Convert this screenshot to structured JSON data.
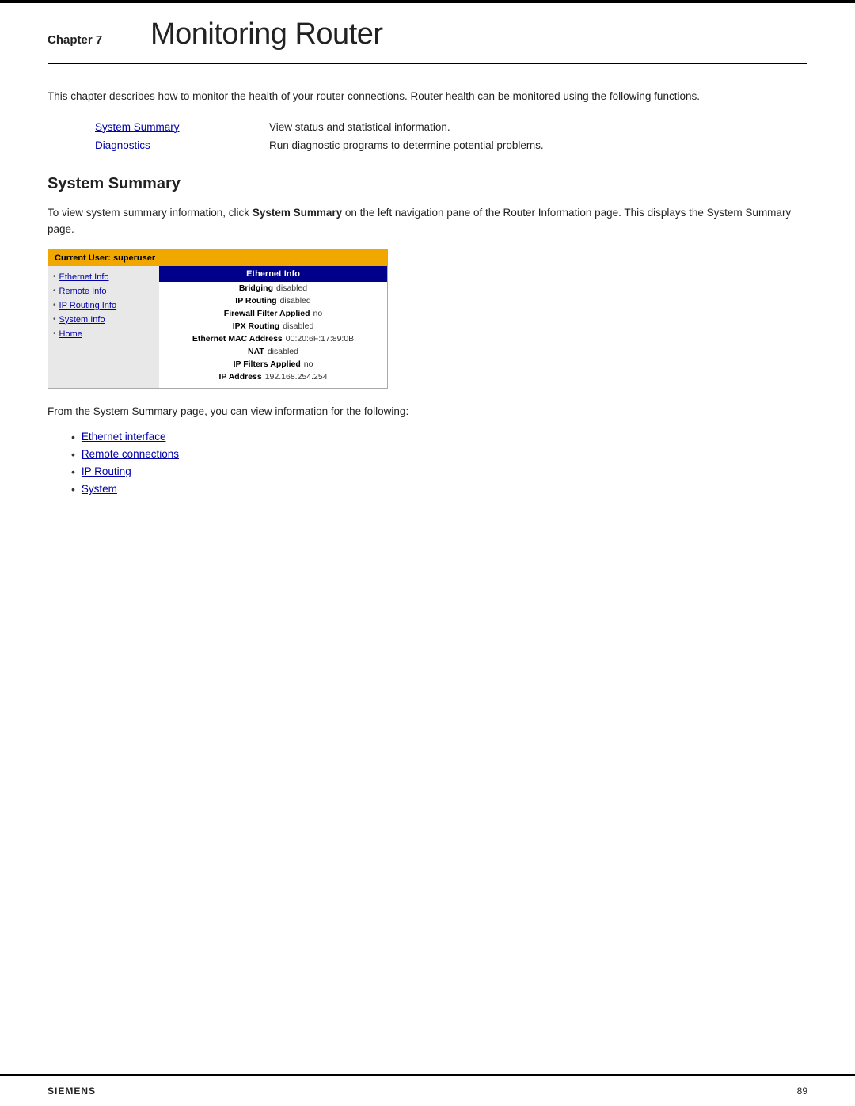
{
  "top_border": true,
  "header": {
    "chapter_label": "Chapter 7",
    "chapter_title": "Monitoring Router"
  },
  "intro": {
    "text": "This chapter describes how to monitor the health of your router connections. Router health can be monitored using the following functions."
  },
  "functions": [
    {
      "link": "System Summary",
      "description": "View status and statistical information."
    },
    {
      "link": "Diagnostics",
      "description": "Run diagnostic programs to determine potential problems."
    }
  ],
  "system_summary": {
    "heading": "System Summary",
    "text": "To view system summary information, click System Summary on the left navigation pane of the Router Information page. This displays the System Summary page.",
    "bold_part": "System Summary",
    "screenshot": {
      "top_bar": "Current User: superuser",
      "nav_items": [
        "Ethernet Info",
        "Remote Info",
        "IP Routing Info",
        "System Info",
        "Home"
      ],
      "info_panel_title": "Ethernet Info",
      "info_rows": [
        {
          "label": "Bridging",
          "value": "disabled"
        },
        {
          "label": "IP Routing",
          "value": "disabled"
        },
        {
          "label": "Firewall Filter Applied",
          "value": "no"
        },
        {
          "label": "IPX Routing",
          "value": "disabled"
        },
        {
          "label": "Ethernet MAC Address",
          "value": "00:20:6F:17:89:0B"
        },
        {
          "label": "NAT",
          "value": "disabled"
        },
        {
          "label": "IP Filters Applied",
          "value": "no"
        },
        {
          "label": "IP Address",
          "value": "192.168.254.254"
        }
      ]
    },
    "after_text": "From the System Summary page, you can view information for the following:",
    "bullet_items": [
      {
        "label": "Ethernet interface",
        "link": true
      },
      {
        "label": "Remote connections",
        "link": true
      },
      {
        "label": "IP Routing",
        "link": true
      },
      {
        "label": "System",
        "link": true
      }
    ]
  },
  "footer": {
    "brand": "SIEMENS",
    "page": "89"
  }
}
